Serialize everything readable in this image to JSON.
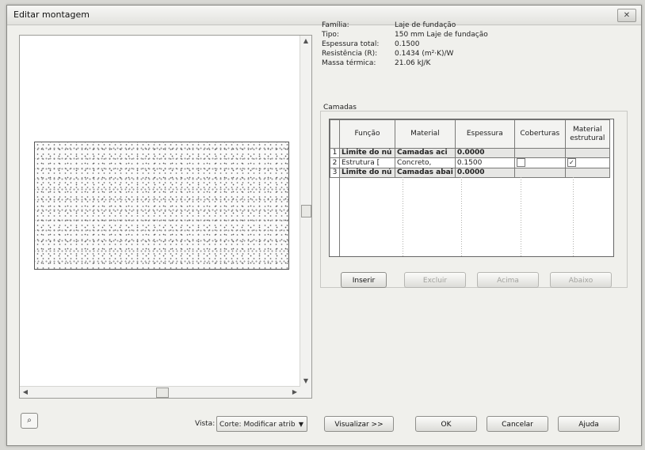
{
  "window": {
    "title": "Editar montagem",
    "close_label": "✕"
  },
  "properties": [
    {
      "label": "Família:",
      "value": "Laje de fundação"
    },
    {
      "label": "Tipo:",
      "value": "150 mm Laje de fundação"
    },
    {
      "label": "Espessura total:",
      "value": "0.1500"
    },
    {
      "label": "Resistência (R):",
      "value": "0.1434 (m²·K)/W"
    },
    {
      "label": "Massa térmica:",
      "value": "21.06 kJ/K"
    }
  ],
  "layers": {
    "group_label": "Camadas",
    "columns": [
      "Função",
      "Material",
      "Espessura",
      "Coberturas",
      "Material estrutural"
    ],
    "rows": [
      {
        "num": "1",
        "function": "Limite do nú",
        "material": "Camadas aci",
        "thickness": "0.0000",
        "boundary": true
      },
      {
        "num": "2",
        "function": "Estrutura [",
        "material": "Concreto,",
        "thickness": "0.1500",
        "boundary": false,
        "coberturas": false,
        "estrutural": true
      },
      {
        "num": "3",
        "function": "Limite do nú",
        "material": "Camadas abai",
        "thickness": "0.0000",
        "boundary": true
      }
    ]
  },
  "layer_buttons": {
    "insert": "Inserir",
    "delete": "Excluir",
    "up": "Acima",
    "down": "Abaixo"
  },
  "footer": {
    "view_label": "Vista:",
    "view_value": "Corte: Modificar atrib",
    "preview_button": "Visualizar >>",
    "ok_button": "OK",
    "cancel_button": "Cancelar",
    "help_button": "Ajuda"
  },
  "icons": {
    "close": "close-icon",
    "zoom": "magnifier-icon",
    "scroll_up": "arrow-up-icon",
    "scroll_down": "arrow-down-icon",
    "scroll_left": "arrow-left-icon",
    "scroll_right": "arrow-right-icon",
    "dropdown": "chevron-down-icon"
  }
}
